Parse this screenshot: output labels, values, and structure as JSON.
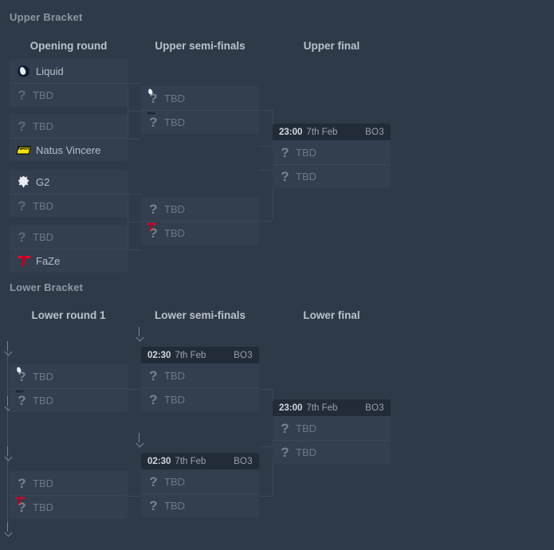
{
  "page": {
    "background": "#2f3a49",
    "accent_header": "#222c39",
    "row_background": "#333f4f"
  },
  "brackets": [
    {
      "id": "upper",
      "title": "Upper Bracket",
      "rounds": [
        {
          "id": "opening-round",
          "label": "Opening round"
        },
        {
          "id": "upper-semi-finals",
          "label": "Upper semi-finals"
        },
        {
          "id": "upper-final",
          "label": "Upper final"
        }
      ]
    },
    {
      "id": "lower",
      "title": "Lower Bracket",
      "rounds": [
        {
          "id": "lower-round-1",
          "label": "Lower round 1"
        },
        {
          "id": "lower-semi-finals",
          "label": "Lower semi-finals"
        },
        {
          "id": "lower-final",
          "label": "Lower final"
        }
      ]
    }
  ],
  "matches": {
    "ub_open_1": {
      "rows": [
        {
          "team": "Liquid",
          "logo": "liquid-logo",
          "tbd": false
        },
        {
          "team": "TBD",
          "logo": "question-icon",
          "tbd": true
        }
      ]
    },
    "ub_open_2": {
      "rows": [
        {
          "team": "TBD",
          "logo": "question-icon",
          "tbd": true
        },
        {
          "team": "Natus Vincere",
          "logo": "navi-logo",
          "tbd": false
        }
      ]
    },
    "ub_open_3": {
      "rows": [
        {
          "team": "G2",
          "logo": "g2-logo",
          "tbd": false
        },
        {
          "team": "TBD",
          "logo": "question-icon",
          "tbd": true
        }
      ]
    },
    "ub_open_4": {
      "rows": [
        {
          "team": "TBD",
          "logo": "question-icon",
          "tbd": true
        },
        {
          "team": "FaZe",
          "logo": "faze-logo",
          "tbd": false
        }
      ]
    },
    "ub_semi_1": {
      "rows": [
        {
          "team": "TBD",
          "logo": "question-icon",
          "seed_logo": "liquid-logo",
          "tbd": true
        },
        {
          "team": "TBD",
          "logo": "question-icon",
          "seed_logo": "navi-logo",
          "tbd": true
        }
      ]
    },
    "ub_semi_2": {
      "rows": [
        {
          "team": "TBD",
          "logo": "question-icon",
          "seed_logo": "g2-logo",
          "tbd": true
        },
        {
          "team": "TBD",
          "logo": "question-icon",
          "seed_logo": "faze-logo",
          "tbd": true
        }
      ]
    },
    "ub_final": {
      "header": {
        "time": "23:00",
        "date": "7th Feb",
        "format": "BO3"
      },
      "rows": [
        {
          "team": "TBD",
          "logo": "question-icon",
          "tbd": true
        },
        {
          "team": "TBD",
          "logo": "question-icon",
          "tbd": true
        }
      ]
    },
    "lb_r1_1": {
      "rows": [
        {
          "team": "TBD",
          "logo": "question-icon",
          "seed_logo": "liquid-logo",
          "tbd": true
        },
        {
          "team": "TBD",
          "logo": "question-icon",
          "seed_logo": "navi-logo",
          "tbd": true
        }
      ]
    },
    "lb_r1_2": {
      "rows": [
        {
          "team": "TBD",
          "logo": "question-icon",
          "seed_logo": "g2-logo",
          "tbd": true
        },
        {
          "team": "TBD",
          "logo": "question-icon",
          "seed_logo": "faze-logo",
          "tbd": true
        }
      ]
    },
    "lb_semi_1": {
      "header": {
        "time": "02:30",
        "date": "7th Feb",
        "format": "BO3"
      },
      "rows": [
        {
          "team": "TBD",
          "logo": "question-icon",
          "tbd": true
        },
        {
          "team": "TBD",
          "logo": "question-icon",
          "tbd": true
        }
      ]
    },
    "lb_semi_2": {
      "header": {
        "time": "02:30",
        "date": "7th Feb",
        "format": "BO3"
      },
      "rows": [
        {
          "team": "TBD",
          "logo": "question-icon",
          "tbd": true
        },
        {
          "team": "TBD",
          "logo": "question-icon",
          "tbd": true
        }
      ]
    },
    "lb_final": {
      "header": {
        "time": "23:00",
        "date": "7th Feb",
        "format": "BO3"
      },
      "rows": [
        {
          "team": "TBD",
          "logo": "question-icon",
          "tbd": true
        },
        {
          "team": "TBD",
          "logo": "question-icon",
          "tbd": true
        }
      ]
    }
  },
  "icons": {
    "question": "?",
    "drop_arrow": "down-arrow-icon"
  }
}
